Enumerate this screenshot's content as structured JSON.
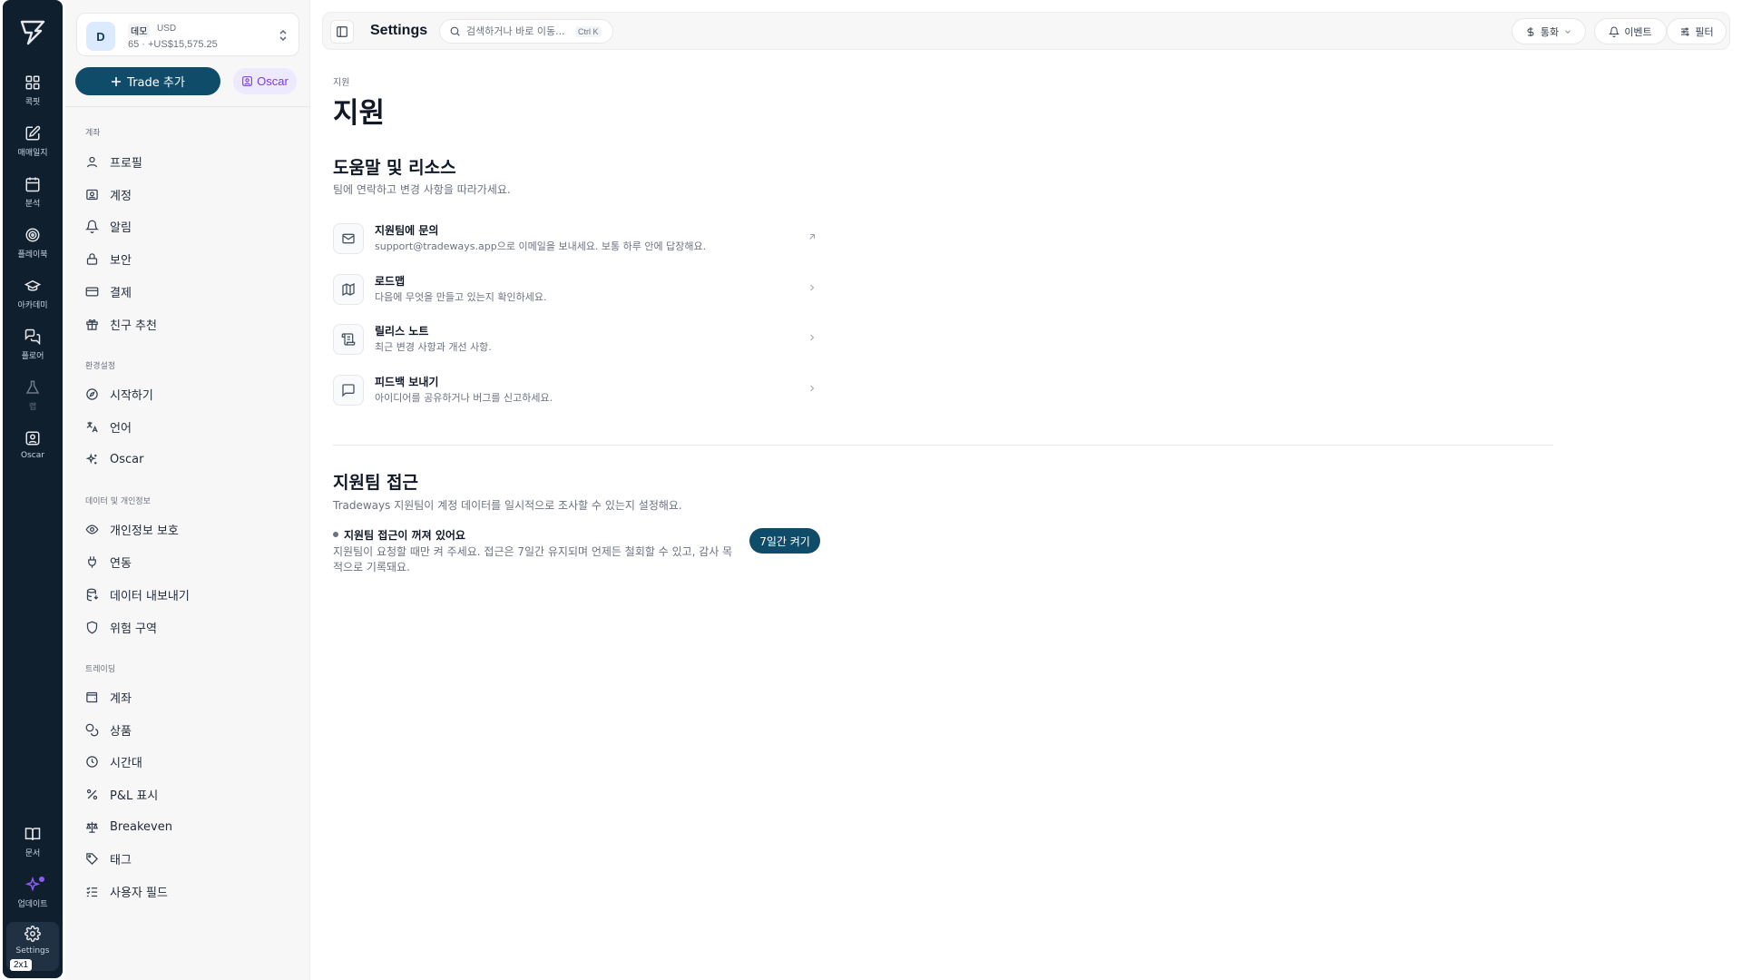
{
  "rail": {
    "items": [
      {
        "label": "콕핏",
        "icon": "dashboard-icon"
      },
      {
        "label": "매매일지",
        "icon": "journal-icon"
      },
      {
        "label": "분석",
        "icon": "calendar-icon"
      },
      {
        "label": "플레이북",
        "icon": "target-icon"
      },
      {
        "label": "아카데미",
        "icon": "graduation-cap-icon"
      },
      {
        "label": "플로어",
        "icon": "chat-icon"
      },
      {
        "label": "랩",
        "icon": "flask-icon"
      },
      {
        "label": "Oscar",
        "icon": "oscar-icon"
      }
    ],
    "bottom": [
      {
        "label": "문서",
        "icon": "book-icon"
      },
      {
        "label": "업데이트",
        "icon": "sparkle-icon"
      },
      {
        "label": "Settings",
        "icon": "gear-icon"
      }
    ],
    "size_badge": "2x1"
  },
  "account": {
    "avatar": "D",
    "badge": "데모",
    "currency": "USD",
    "balance": "65 · +US$15,575.25"
  },
  "sidebar": {
    "trade_button": "Trade 추가",
    "oscar_button": "Oscar",
    "sections": [
      {
        "label": "계좌",
        "items": [
          "프로필",
          "계정",
          "알림",
          "보안",
          "결제",
          "친구 추천"
        ]
      },
      {
        "label": "환경설정",
        "items": [
          "시작하기",
          "언어",
          "Oscar"
        ]
      },
      {
        "label": "데이터 및 개인정보",
        "items": [
          "개인정보 보호",
          "연동",
          "데이터 내보내기",
          "위험 구역"
        ]
      },
      {
        "label": "트레이딩",
        "items": [
          "계좌",
          "상품",
          "시간대",
          "P&L 표시",
          "Breakeven",
          "태그",
          "사용자 필드"
        ]
      }
    ]
  },
  "topbar": {
    "title": "Settings",
    "search_placeholder": "검색하거나 바로 이동...",
    "search_shortcut": "Ctrl K",
    "currency_button": "통화",
    "events_button": "이벤트",
    "filter_button": "필터"
  },
  "main": {
    "breadcrumb": "지원",
    "title": "지원",
    "resources": {
      "title": "도움말 및 리소스",
      "subtitle": "팀에 연락하고 변경 사항을 따라가세요.",
      "items": [
        {
          "title": "지원팀에 문의",
          "desc": "support@tradeways.app으로 이메일을 보내세요. 보통 하루 안에 답장해요.",
          "icon": "mail-icon"
        },
        {
          "title": "로드맵",
          "desc": "다음에 무엇을 만들고 있는지 확인하세요.",
          "icon": "map-icon"
        },
        {
          "title": "릴리스 노트",
          "desc": "최근 변경 사항과 개선 사항.",
          "icon": "scroll-icon"
        },
        {
          "title": "피드백 보내기",
          "desc": "아이디어를 공유하거나 버그를 신고하세요.",
          "icon": "message-icon"
        }
      ]
    },
    "access": {
      "title": "지원팀 접근",
      "subtitle": "Tradeways 지원팀이 계정 데이터를 일시적으로 조사할 수 있는지 설정해요.",
      "status": "지원팀 접근이 꺼져 있어요",
      "description": "지원팀이 요청할 때만 켜 주세요. 접근은 7일간 유지되며 언제든 철회할 수 있고, 감사 목적으로 기록돼요.",
      "button": "7일간 켜기"
    }
  },
  "colors": {
    "rail_bg": "#0f1f2e",
    "primary": "#0f4c6a",
    "oscar_accent": "#7c3aed"
  }
}
